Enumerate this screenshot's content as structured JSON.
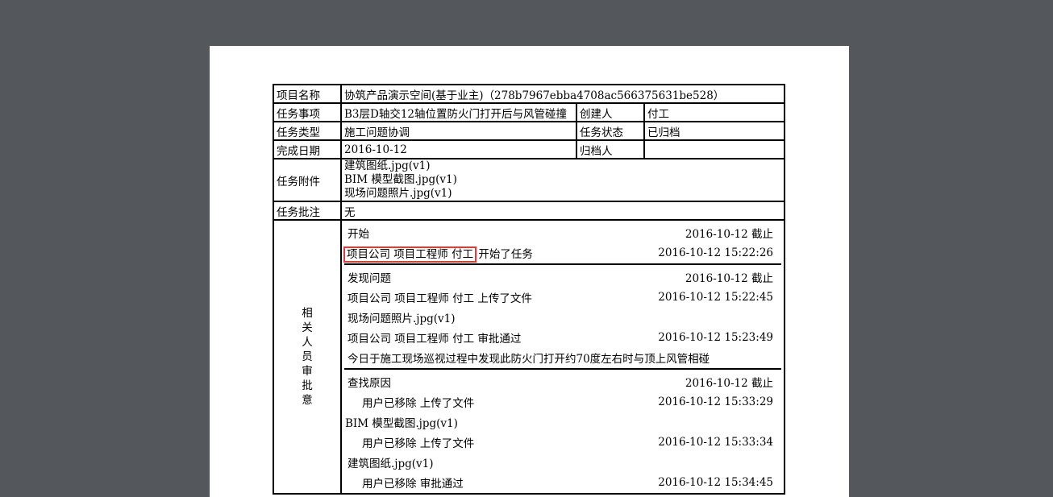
{
  "fields": {
    "project_name_label": "项目名称",
    "project_name_value": "协筑产品演示空间(基于业主)（278b7967ebba4708ac566375631be528）",
    "task_item_label": "任务事项",
    "task_item_value": "B3层D轴交12轴位置防火门打开后与风管碰撞",
    "creator_label": "创建人",
    "creator_value": "付工",
    "task_type_label": "任务类型",
    "task_type_value": "施工问题协调",
    "task_status_label": "任务状态",
    "task_status_value": "已归档",
    "finish_date_label": "完成日期",
    "finish_date_value": "2016-10-12",
    "archiver_label": "归档人",
    "archiver_value": "",
    "attachments_label": "任务附件",
    "attachments": [
      "建筑图纸.jpg(v1)",
      "BIM 模型截图.jpg(v1)",
      "现场问题照片.jpg(v1)"
    ],
    "note_label": "任务批注",
    "note_value": "无",
    "related_label_chars": [
      "相",
      "关",
      "人",
      "员",
      "审",
      "批",
      "意"
    ]
  },
  "stages": [
    {
      "title": "开始",
      "deadline": "2016-10-12 截止",
      "entries": [
        {
          "text": "项目公司  项目工程师  付工",
          "suffix": " 开始了任务",
          "time": "2016-10-12 15:22:26",
          "highlight": true
        }
      ]
    },
    {
      "title": "发现问题",
      "deadline": "2016-10-12 截止",
      "entries": [
        {
          "text": "项目公司  项目工程师  付工  上传了文件",
          "time": "2016-10-12 15:22:45"
        },
        {
          "text": "现场问题照片.jpg(v1)",
          "time": ""
        },
        {
          "text": "项目公司  项目工程师  付工  审批通过",
          "time": "2016-10-12 15:23:49"
        },
        {
          "text": "今日于施工现场巡视过程中发现此防火门打开约70度左右时与顶上风管相碰",
          "time": ""
        }
      ]
    },
    {
      "title": "查找原因",
      "deadline": "2016-10-12 截止",
      "entries": [
        {
          "text": "用户已移除  上传了文件",
          "time": "2016-10-12 15:33:29",
          "indent": true
        },
        {
          "text": "BIM 模型截图.jpg(v1)",
          "time": "",
          "flush": true
        },
        {
          "text": "用户已移除  上传了文件",
          "time": "2016-10-12 15:33:34",
          "indent": true
        },
        {
          "text": "建筑图纸.jpg(v1)",
          "time": ""
        },
        {
          "text": "用户已移除  审批通过",
          "time": "2016-10-12 15:34:45",
          "indent": true
        }
      ]
    }
  ]
}
